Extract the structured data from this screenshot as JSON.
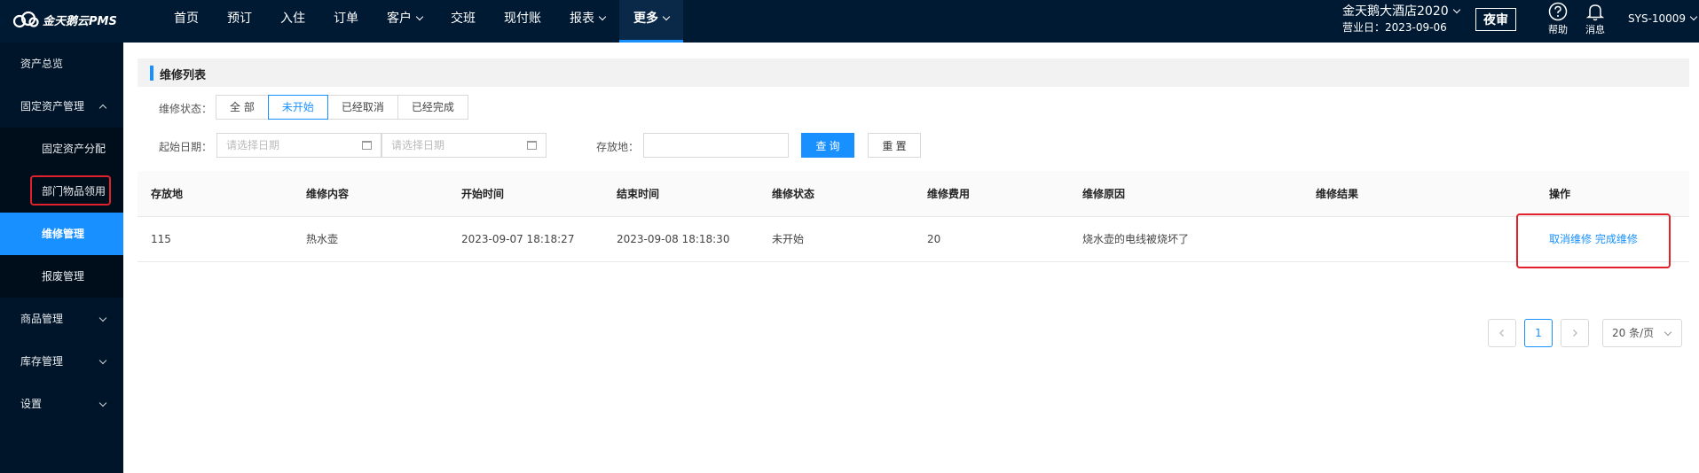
{
  "app": {
    "logo_text": "金天鹅云PMS"
  },
  "nav": [
    {
      "label": "首页",
      "dropdown": false
    },
    {
      "label": "预订",
      "dropdown": false
    },
    {
      "label": "入住",
      "dropdown": false
    },
    {
      "label": "订单",
      "dropdown": false
    },
    {
      "label": "客户",
      "dropdown": true
    },
    {
      "label": "交班",
      "dropdown": false
    },
    {
      "label": "现付账",
      "dropdown": false
    },
    {
      "label": "报表",
      "dropdown": true
    },
    {
      "label": "更多",
      "dropdown": true,
      "active": true
    }
  ],
  "header": {
    "hotel_name": "金天鹅大酒店2020",
    "business_date": "营业日：2023-09-06",
    "night_audit": "夜审",
    "help": "帮助",
    "messages": "消息",
    "user": "SYS-10009"
  },
  "sidebar": {
    "items": [
      {
        "label": "资产总览",
        "level": 1
      },
      {
        "label": "固定资产管理",
        "level": 1,
        "expanded": true
      },
      {
        "label": "固定资产分配",
        "level": 2
      },
      {
        "label": "部门物品领用",
        "level": 2
      },
      {
        "label": "维修管理",
        "level": 2,
        "active": true
      },
      {
        "label": "报废管理",
        "level": 2
      },
      {
        "label": "商品管理",
        "level": 1,
        "expanded": false
      },
      {
        "label": "库存管理",
        "level": 1,
        "expanded": false
      },
      {
        "label": "设置",
        "level": 1,
        "expanded": false
      }
    ]
  },
  "main": {
    "title": "维修列表",
    "filters": {
      "status_label": "维修状态：",
      "status_options": [
        "全 部",
        "未开始",
        "已经取消",
        "已经完成"
      ],
      "status_selected": "未开始",
      "start_date_label": "起始日期：",
      "date_placeholder": "请选择日期",
      "location_label": "存放地：",
      "location_value": "",
      "query_button": "查 询",
      "reset_button": "重 置"
    },
    "table": {
      "columns": [
        "存放地",
        "维修内容",
        "开始时间",
        "结束时间",
        "维修状态",
        "维修费用",
        "维修原因",
        "维修结果",
        "操作"
      ],
      "rows": [
        {
          "location": "115",
          "content": "热水壶",
          "start_time": "2023-09-07 18:18:27",
          "end_time": "2023-09-08 18:18:30",
          "status": "未开始",
          "cost": "20",
          "reason": "烧水壶的电线被烧坏了",
          "result": "",
          "actions": [
            "取消维修",
            "完成维修"
          ]
        }
      ]
    },
    "pagination": {
      "current_page": "1",
      "page_size": "20 条/页"
    }
  },
  "colors": {
    "topbar": "#001a33",
    "sidebar": "#001529",
    "primary": "#1890ff",
    "highlight_box": "#e0212b"
  }
}
